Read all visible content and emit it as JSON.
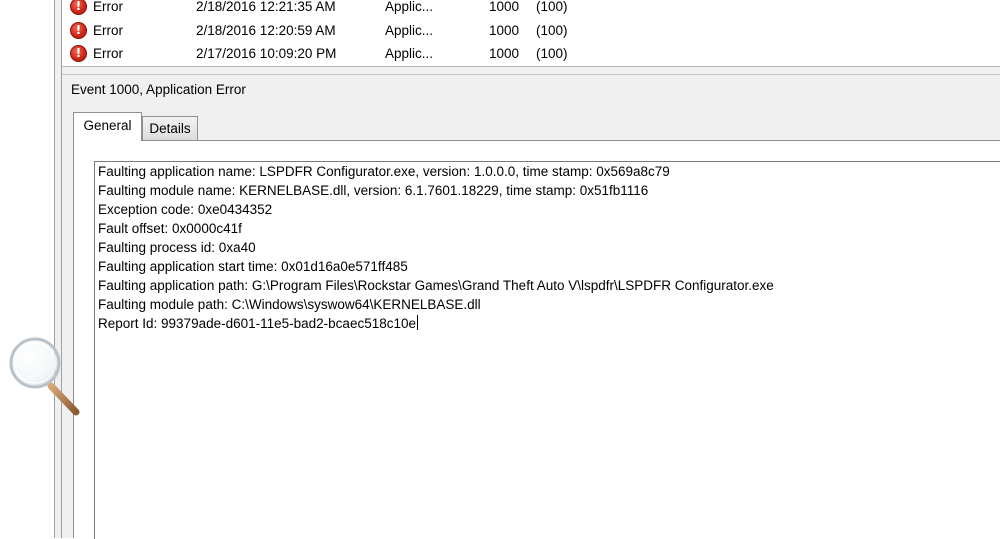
{
  "event_list": {
    "rows": [
      {
        "level": "Error",
        "date_time": "2/18/2016 12:21:35 AM",
        "source": "Applic...",
        "event_id": "1000",
        "task_category": "(100)"
      },
      {
        "level": "Error",
        "date_time": "2/18/2016 12:20:59 AM",
        "source": "Applic...",
        "event_id": "1000",
        "task_category": "(100)"
      },
      {
        "level": "Error",
        "date_time": "2/17/2016 10:09:20 PM",
        "source": "Applic...",
        "event_id": "1000",
        "task_category": "(100)"
      }
    ],
    "icon": "error-icon",
    "error_color": "#d1281a"
  },
  "detail": {
    "title": "Event 1000, Application Error",
    "tabs": [
      {
        "label": "General",
        "selected": true
      },
      {
        "label": "Details",
        "selected": false
      }
    ],
    "lines": [
      "Faulting application name: LSPDFR Configurator.exe, version: 1.0.0.0, time stamp: 0x569a8c79",
      "Faulting module name: KERNELBASE.dll, version: 6.1.7601.18229, time stamp: 0x51fb1116",
      "Exception code: 0xe0434352",
      "Fault offset: 0x0000c41f",
      "Faulting process id: 0xa40",
      "Faulting application start time: 0x01d16a0e571ff485",
      "Faulting application path: G:\\Program Files\\Rockstar Games\\Grand Theft Auto V\\lspdfr\\LSPDFR Configurator.exe",
      "Faulting module path: C:\\Windows\\syswow64\\KERNELBASE.dll",
      "Report Id: 99379ade-d601-11e5-bad2-bcaec518c10e"
    ]
  },
  "decorations": {
    "magnifier_icon": "magnifier-icon"
  }
}
